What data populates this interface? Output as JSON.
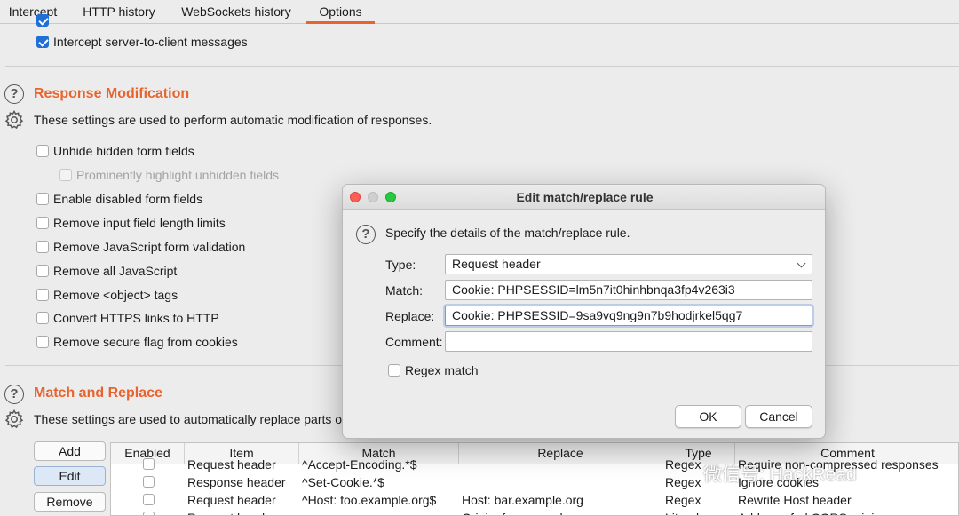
{
  "tabs": [
    {
      "label": "Intercept",
      "active": false
    },
    {
      "label": "HTTP history",
      "active": false
    },
    {
      "label": "WebSockets history",
      "active": false
    },
    {
      "label": "Options",
      "active": true
    }
  ],
  "top_option": {
    "label": "Intercept server-to-client messages",
    "checked": true
  },
  "response_modification": {
    "title": "Response Modification",
    "description": "These settings are used to perform automatic modification of responses.",
    "options": [
      {
        "label": "Unhide hidden form fields",
        "checked": false,
        "enabled": true
      },
      {
        "label": "Prominently highlight unhidden fields",
        "checked": false,
        "enabled": false
      },
      {
        "label": "Enable disabled form fields",
        "checked": false,
        "enabled": true
      },
      {
        "label": "Remove input field length limits",
        "checked": false,
        "enabled": true
      },
      {
        "label": "Remove JavaScript form validation",
        "checked": false,
        "enabled": true
      },
      {
        "label": "Remove all JavaScript",
        "checked": false,
        "enabled": true
      },
      {
        "label": "Remove <object> tags",
        "checked": false,
        "enabled": true
      },
      {
        "label": "Convert HTTPS links to HTTP",
        "checked": false,
        "enabled": true
      },
      {
        "label": "Remove secure flag from cookies",
        "checked": false,
        "enabled": true
      }
    ]
  },
  "match_replace": {
    "title": "Match and Replace",
    "description": "These settings are used to automatically replace parts of",
    "buttons": {
      "add": "Add",
      "edit": "Edit",
      "remove": "Remove"
    },
    "columns": [
      "Enabled",
      "Item",
      "Match",
      "Replace",
      "Type",
      "Comment"
    ],
    "rows": [
      {
        "item": "Request header",
        "match": "^Accept-Encoding.*$",
        "replace": "",
        "type": "Regex",
        "comment": "Require non-compressed responses"
      },
      {
        "item": "Response header",
        "match": "^Set-Cookie.*$",
        "replace": "",
        "type": "Regex",
        "comment": "Ignore cookies"
      },
      {
        "item": "Request header",
        "match": "^Host: foo.example.org$",
        "replace": "Host: bar.example.org",
        "type": "Regex",
        "comment": "Rewrite Host header"
      },
      {
        "item": "Request header",
        "match": "",
        "replace": "Origin: foo.example.org",
        "type": "Literal",
        "comment": "Add spoofed CORS origin"
      }
    ]
  },
  "dialog": {
    "title": "Edit match/replace rule",
    "instruction": "Specify the details of the match/replace rule.",
    "type_label": "Type:",
    "type_value": "Request header",
    "match_label": "Match:",
    "match_value": "Cookie: PHPSESSID=lm5n7it0hinhbnqa3fp4v263i3",
    "replace_label": "Replace:",
    "replace_value": "Cookie: PHPSESSID=9sa9vq9ng9n7b9hodjrkel5qg7",
    "comment_label": "Comment:",
    "comment_value": "",
    "regex_label": "Regex match",
    "regex_checked": false,
    "ok_label": "OK",
    "cancel_label": "Cancel"
  },
  "watermark": "微信号: HackRead",
  "colors": {
    "accent": "#e8642e",
    "checkbox_checked": "#1f6fd6"
  }
}
